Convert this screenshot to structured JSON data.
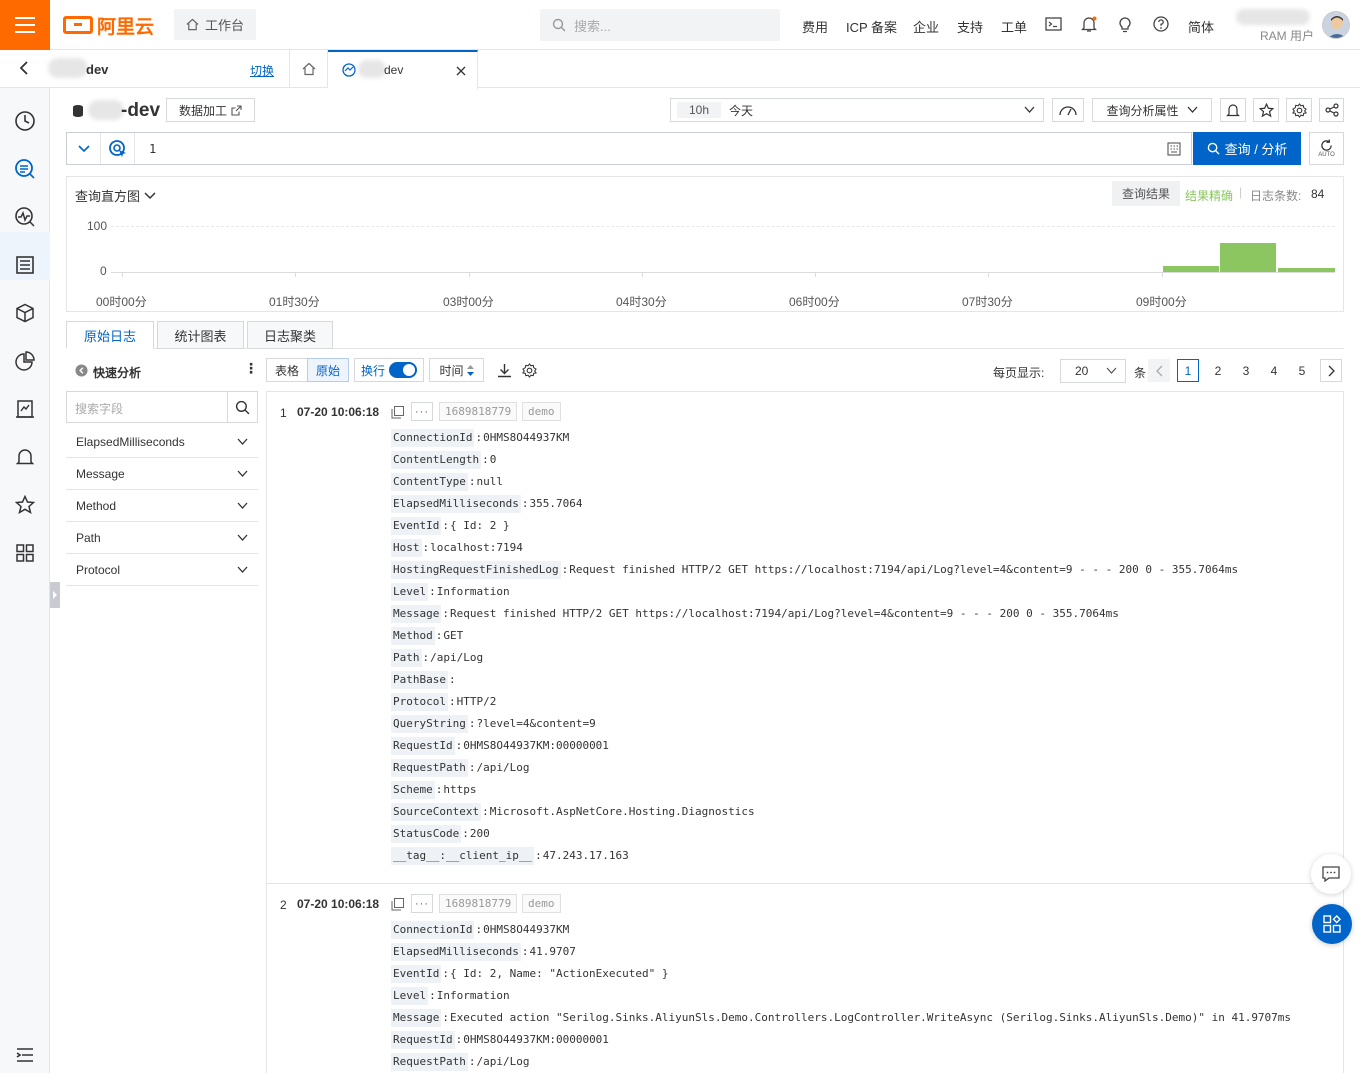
{
  "header": {
    "logo_text": "阿里云",
    "workbench": "工作台",
    "search_placeholder": "搜索...",
    "nav": [
      "费用",
      "ICP 备案",
      "企业",
      "支持",
      "工单"
    ],
    "lang": "简体",
    "user_role": "RAM 用户",
    "brand_color": "#ff6a00"
  },
  "project_bar": {
    "project_name": "dev",
    "switch": "切换",
    "tab_name": "dev"
  },
  "logstore": {
    "name": "-dev",
    "data_processing": "数据加工",
    "time_range_badge": "10h",
    "time_range_label": "今天",
    "analysis_props": "查询分析属性",
    "query_text": "1",
    "query_button": "查询 / 分析",
    "auto_label": "AUTO"
  },
  "histogram": {
    "title": "查询直方图",
    "result_btn": "查询结果",
    "accuracy": "结果精确",
    "log_count_label": "日志条数:",
    "log_count": "84",
    "y_ticks": [
      "100",
      "0"
    ],
    "x_ticks": [
      "00时00分",
      "01时30分",
      "03时00分",
      "04时30分",
      "06时00分",
      "07时30分",
      "09时00分"
    ],
    "bar_color": "#8bc661",
    "bars": [
      {
        "slot": "09:00-09:30",
        "count": 13
      },
      {
        "slot": "09:30-10:00",
        "count": 62
      },
      {
        "slot": "10:00-10:30",
        "count": 9
      }
    ],
    "ymax": 100
  },
  "view_tabs": [
    "原始日志",
    "统计图表",
    "日志聚类"
  ],
  "quick_analysis": {
    "title": "快速分析",
    "search_placeholder": "搜索字段",
    "fields": [
      "ElapsedMilliseconds",
      "Message",
      "Method",
      "Path",
      "Protocol"
    ]
  },
  "toolbar": {
    "table": "表格",
    "raw": "原始",
    "wrap": "换行",
    "time": "时间",
    "per_page_label": "每页显示:",
    "per_page": "20",
    "unit": "条",
    "pages": [
      "1",
      "2",
      "3",
      "4",
      "5"
    ]
  },
  "logs": [
    {
      "index": "1",
      "time": "07-20 10:06:18",
      "source": "1689818779",
      "topic": "demo",
      "fields": [
        {
          "k": "ConnectionId",
          "v": "0HMS8O44937KM"
        },
        {
          "k": "ContentLength",
          "v": "0"
        },
        {
          "k": "ContentType",
          "v": "null"
        },
        {
          "k": "ElapsedMilliseconds",
          "v": "355.7064"
        },
        {
          "k": "EventId",
          "v": "{ Id: 2 }"
        },
        {
          "k": "Host",
          "v": "localhost:7194"
        },
        {
          "k": "HostingRequestFinishedLog",
          "v": "Request finished HTTP/2 GET https://localhost:7194/api/Log?level=4&content=9 - - - 200 0 - 355.7064ms"
        },
        {
          "k": "Level",
          "v": "Information"
        },
        {
          "k": "Message",
          "v": "Request finished HTTP/2 GET https://localhost:7194/api/Log?level=4&content=9 - - - 200 0 - 355.7064ms"
        },
        {
          "k": "Method",
          "v": "GET"
        },
        {
          "k": "Path",
          "v": "/api/Log"
        },
        {
          "k": "PathBase",
          "v": ""
        },
        {
          "k": "Protocol",
          "v": "HTTP/2"
        },
        {
          "k": "QueryString",
          "v": "?level=4&content=9"
        },
        {
          "k": "RequestId",
          "v": "0HMS8O44937KM:00000001"
        },
        {
          "k": "RequestPath",
          "v": "/api/Log"
        },
        {
          "k": "Scheme",
          "v": "https"
        },
        {
          "k": "SourceContext",
          "v": "Microsoft.AspNetCore.Hosting.Diagnostics"
        },
        {
          "k": "StatusCode",
          "v": "200"
        },
        {
          "k": "__tag__:__client_ip__",
          "v": "47.243.17.163"
        }
      ]
    },
    {
      "index": "2",
      "time": "07-20 10:06:18",
      "source": "1689818779",
      "topic": "demo",
      "fields": [
        {
          "k": "ConnectionId",
          "v": "0HMS8O44937KM"
        },
        {
          "k": "ElapsedMilliseconds",
          "v": "41.9707"
        },
        {
          "k": "EventId",
          "v": "{ Id: 2, Name: \"ActionExecuted\" }"
        },
        {
          "k": "Level",
          "v": "Information"
        },
        {
          "k": "Message",
          "v": "Executed action \"Serilog.Sinks.AliyunSls.Demo.Controllers.LogController.WriteAsync (Serilog.Sinks.AliyunSls.Demo)\" in 41.9707ms"
        },
        {
          "k": "RequestId",
          "v": "0HMS8O44937KM:00000001"
        },
        {
          "k": "RequestPath",
          "v": "/api/Log"
        }
      ]
    }
  ]
}
